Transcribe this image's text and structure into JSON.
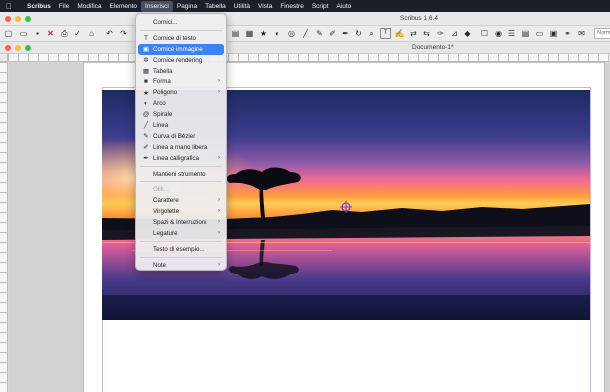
{
  "menubar": {
    "items": [
      {
        "label": "Scribus",
        "app": true
      },
      {
        "label": "File"
      },
      {
        "label": "Modifica"
      },
      {
        "label": "Elemento"
      },
      {
        "label": "Inserisci",
        "active": true
      },
      {
        "label": "Pagina"
      },
      {
        "label": "Tabella"
      },
      {
        "label": "Utilità"
      },
      {
        "label": "Vista"
      },
      {
        "label": "Finestre"
      },
      {
        "label": "Script"
      },
      {
        "label": "Aiuto"
      }
    ]
  },
  "app": {
    "title": "Scribus 1.6.4"
  },
  "document": {
    "title": "Documento-1*"
  },
  "toolbar": {
    "zoom_value": "Norm"
  },
  "insert_menu": {
    "items": [
      {
        "label": "Cornici...",
        "icon": "",
        "icon_name": "none"
      },
      {
        "sep": true
      },
      {
        "label": "Cornice di testo",
        "icon": "T",
        "icon_name": "text-frame-icon"
      },
      {
        "label": "Cornice immagine",
        "icon": "▣",
        "icon_name": "image-frame-icon",
        "highlighted": true
      },
      {
        "label": "Cornice rendering",
        "icon": "✲",
        "icon_name": "render-frame-icon"
      },
      {
        "label": "Tabella",
        "icon": "▦",
        "icon_name": "table-icon"
      },
      {
        "label": "Forma",
        "icon": "■",
        "icon_name": "shape-icon",
        "submenu": true
      },
      {
        "label": "Poligono",
        "icon": "★",
        "icon_name": "polygon-icon",
        "submenu": true
      },
      {
        "label": "Arco",
        "icon": "◐",
        "icon_name": "arc-icon"
      },
      {
        "label": "Spirale",
        "icon": "@",
        "icon_name": "spiral-icon"
      },
      {
        "label": "Linea",
        "icon": "╱",
        "icon_name": "line-icon"
      },
      {
        "label": "Curva di Bézier",
        "icon": "✎",
        "icon_name": "bezier-icon"
      },
      {
        "label": "Linea a mano libera",
        "icon": "✐",
        "icon_name": "freehand-icon"
      },
      {
        "label": "Linea calligrafica",
        "icon": "✒",
        "icon_name": "calligraphic-icon",
        "submenu": true
      },
      {
        "sep": true
      },
      {
        "label": "Mantieni strumento",
        "icon": "",
        "icon_name": "none"
      },
      {
        "sep": true
      },
      {
        "label": "Glifi...",
        "icon": "",
        "icon_name": "none",
        "disabled": true
      },
      {
        "label": "Carattere",
        "icon": "",
        "icon_name": "none",
        "submenu": true
      },
      {
        "label": "Virgolette",
        "icon": "",
        "icon_name": "none",
        "submenu": true
      },
      {
        "label": "Spazi & Interruzioni",
        "icon": "",
        "icon_name": "none",
        "submenu": true
      },
      {
        "label": "Legature",
        "icon": "",
        "icon_name": "none",
        "submenu": true
      },
      {
        "sep": true
      },
      {
        "label": "Testo di esempio...",
        "icon": "",
        "icon_name": "none"
      },
      {
        "sep": true
      },
      {
        "label": "Note",
        "icon": "",
        "icon_name": "none",
        "submenu": true
      }
    ]
  },
  "colors": {
    "menubar_bg": "#1b1f2a",
    "highlight": "#3b82f6",
    "sky_top": "#1c2a63",
    "sky_horizon": "#ff9a3c",
    "sky_pink": "#f06a96",
    "cursor": "#7b3fe4"
  }
}
